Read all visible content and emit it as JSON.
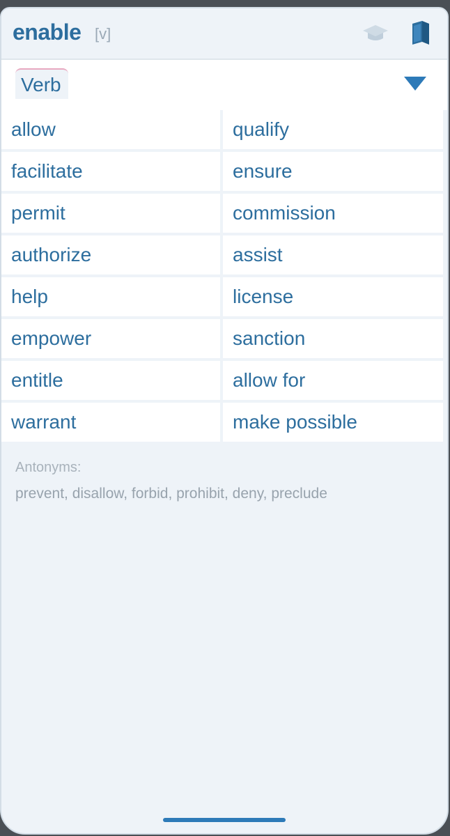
{
  "header": {
    "word": "enable",
    "pos_tag": "[v]",
    "icons": [
      "graduation-cap-icon",
      "book-icon"
    ]
  },
  "pos_selector": {
    "selected": "Verb"
  },
  "synonyms": [
    {
      "left": "allow",
      "right": "qualify"
    },
    {
      "left": "facilitate",
      "right": "ensure"
    },
    {
      "left": "permit",
      "right": "commission"
    },
    {
      "left": "authorize",
      "right": "assist"
    },
    {
      "left": "help",
      "right": "license"
    },
    {
      "left": "empower",
      "right": "sanction"
    },
    {
      "left": "entitle",
      "right": "allow for"
    },
    {
      "left": "warrant",
      "right": "make possible"
    }
  ],
  "antonyms": {
    "label": "Antonyms:",
    "words": "prevent, disallow, forbid, prohibit, deny, preclude"
  },
  "colors": {
    "accent": "#2d6e9e",
    "arrow": "#2d7ab8",
    "background": "#eef3f8"
  }
}
